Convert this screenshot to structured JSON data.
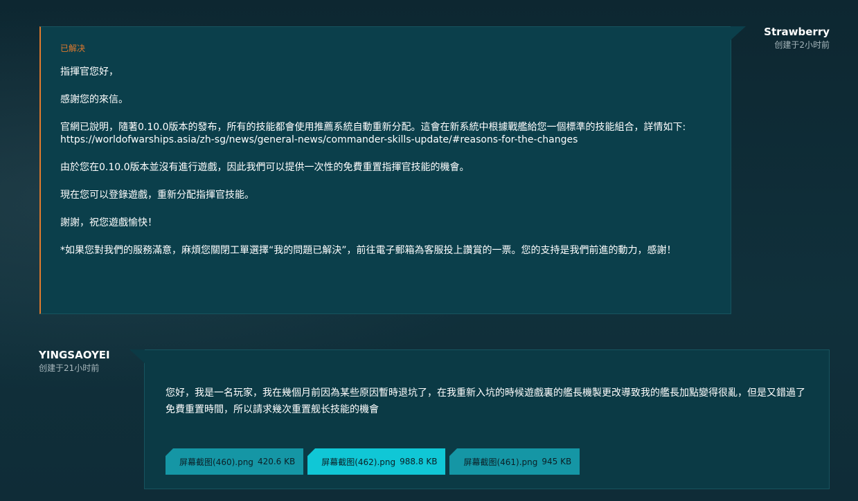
{
  "support_reply": {
    "author": "Strawberry",
    "time": "创建于2小时前",
    "status": "已解决",
    "paragraphs": [
      "指揮官您好，",
      "感謝您的來信。",
      "官網已說明，隨著0.10.0版本的發布，所有的技能都會使用推薦系統自動重新分配。這會在新系統中根據戰艦給您一個標準的技能組合，詳情如下:",
      "https://worldofwarships.asia/zh-sg/news/general-news/commander-skills-update/#reasons-for-the-changes",
      "由於您在0.10.0版本並沒有進行遊戲，因此我們可以提供一次性的免費重置指揮官技能的機會。",
      "現在您可以登錄遊戲，重新分配指揮官技能。",
      "謝謝，祝您遊戲愉快！",
      "*如果您對我們的服務滿意，麻煩您關閉工單選擇“我的問題已解決”，前往電子郵箱為客服投上讚賞的一票。您的支持是我們前進的動力，感謝！"
    ]
  },
  "user_message": {
    "author": "YINGSAOYEI",
    "time": "创建于21小时前",
    "text": "您好，我是一名玩家，我在幾個月前因為某些原因暫時退坑了，在我重新入坑的時候遊戲裏的艦長機製更改導致我的艦長加點變得很亂，但是又錯過了免費重置時間，所以請求幾次重置舰长技能的機會",
    "attachments": [
      {
        "name": "屏幕截图(460).png",
        "size": "420.6 KB"
      },
      {
        "name": "屏幕截图(462).png",
        "size": "988.8 KB"
      },
      {
        "name": "屏幕截图(461).png",
        "size": "945 KB"
      }
    ]
  },
  "colors": {
    "accent_orange": "#e07a2e",
    "attachment": "#1596a5",
    "attachment_active": "#10c7d6"
  }
}
